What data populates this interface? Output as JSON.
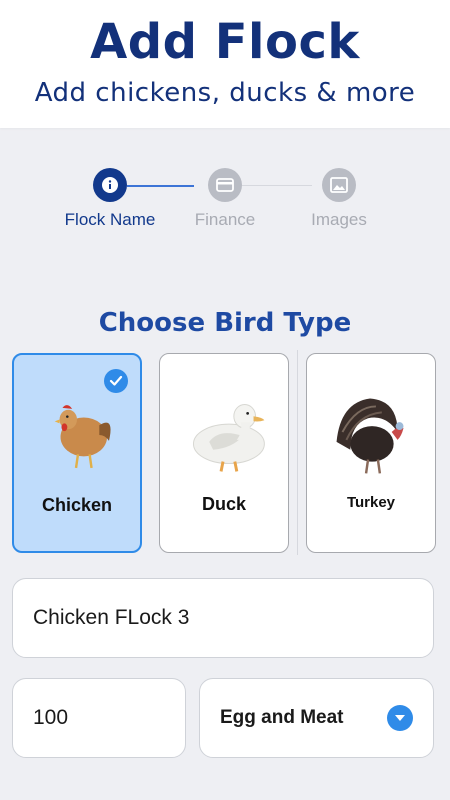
{
  "header": {
    "title": "Add Flock",
    "subtitle": "Add chickens, ducks & more"
  },
  "stepper": {
    "steps": [
      {
        "label": "Flock Name",
        "icon": "info-icon",
        "state": "active"
      },
      {
        "label": "Finance",
        "icon": "card-icon",
        "state": "inactive"
      },
      {
        "label": "Images",
        "icon": "image-icon",
        "state": "inactive"
      }
    ]
  },
  "bird_type": {
    "title": "Choose Bird Type",
    "options": [
      {
        "label": "Chicken",
        "selected": true
      },
      {
        "label": "Duck",
        "selected": false
      },
      {
        "label": "Turkey",
        "selected": false
      }
    ]
  },
  "form": {
    "flock_name_value": "Chicken FLock 3",
    "count_value": "100",
    "purpose_value": "Egg and Meat"
  },
  "colors": {
    "primary_dark": "#13317a",
    "accent_blue": "#2f8be8",
    "selected_bg": "#bfdcfb",
    "inactive_gray": "#b9bcc4"
  }
}
